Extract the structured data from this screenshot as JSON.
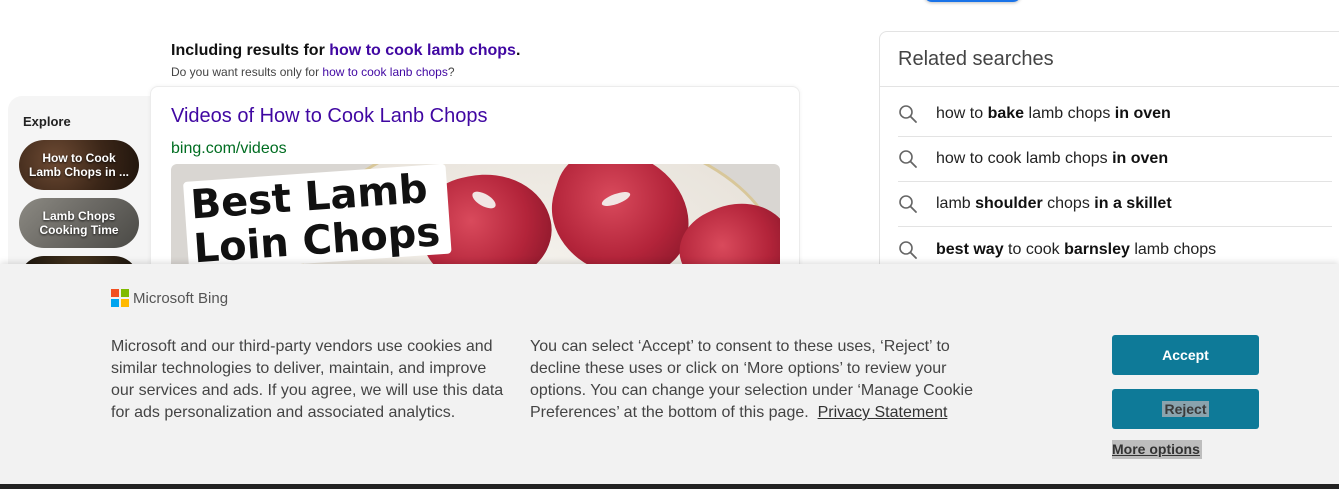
{
  "header": {
    "including_prefix": "Including results for",
    "including_query": "how to cook lamb chops",
    "including_suffix": ".",
    "did_you_prefix": "Do you want results only for",
    "did_you_query": "how to cook lanb chops",
    "did_you_suffix": "?"
  },
  "explore": {
    "title": "Explore",
    "items": [
      {
        "label": "How to Cook Lamb Chops in ..."
      },
      {
        "label": "Lamb Chops Cooking Time"
      },
      {
        "label": ""
      }
    ]
  },
  "video_result": {
    "title": "Videos of How to Cook Lanb Chops",
    "url": "bing.com/videos",
    "thumbnail_text_line1": "Best Lamb",
    "thumbnail_text_line2": "Loin Chops"
  },
  "related_searches": {
    "title": "Related searches",
    "items": [
      {
        "parts": [
          {
            "t": "how to ",
            "b": false
          },
          {
            "t": "bake",
            "b": true
          },
          {
            "t": " lamb chops ",
            "b": false
          },
          {
            "t": "in oven",
            "b": true
          }
        ]
      },
      {
        "parts": [
          {
            "t": "how to cook lamb chops ",
            "b": false
          },
          {
            "t": "in oven",
            "b": true
          }
        ]
      },
      {
        "parts": [
          {
            "t": "lamb ",
            "b": false
          },
          {
            "t": "shoulder",
            "b": true
          },
          {
            "t": " chops ",
            "b": false
          },
          {
            "t": "in a skillet",
            "b": true
          }
        ]
      },
      {
        "parts": [
          {
            "t": "best way",
            "b": true
          },
          {
            "t": " to cook ",
            "b": false
          },
          {
            "t": "barnsley",
            "b": true
          },
          {
            "t": " lamb chops",
            "b": false
          }
        ]
      }
    ],
    "icon": "search-icon"
  },
  "cookie_banner": {
    "brand": "Microsoft Bing",
    "logo_colors": [
      "#f25022",
      "#7fba00",
      "#00a4ef",
      "#ffb900"
    ],
    "text_left": "Microsoft and our third-party vendors use cookies and similar technologies to deliver, maintain, and improve our services and ads. If you agree, we will use this data for ads personalization and associated analytics.",
    "text_right": "You can select ‘Accept’ to consent to these uses, ‘Reject’ to decline these uses or click on ‘More options’ to review your options. You can change your selection under ‘Manage Cookie Preferences’ at the bottom of this page.",
    "privacy_link": "Privacy Statement",
    "accept_label": "Accept",
    "reject_label": "Reject",
    "more_options_label": "More options",
    "button_color": "#0e7a98"
  }
}
